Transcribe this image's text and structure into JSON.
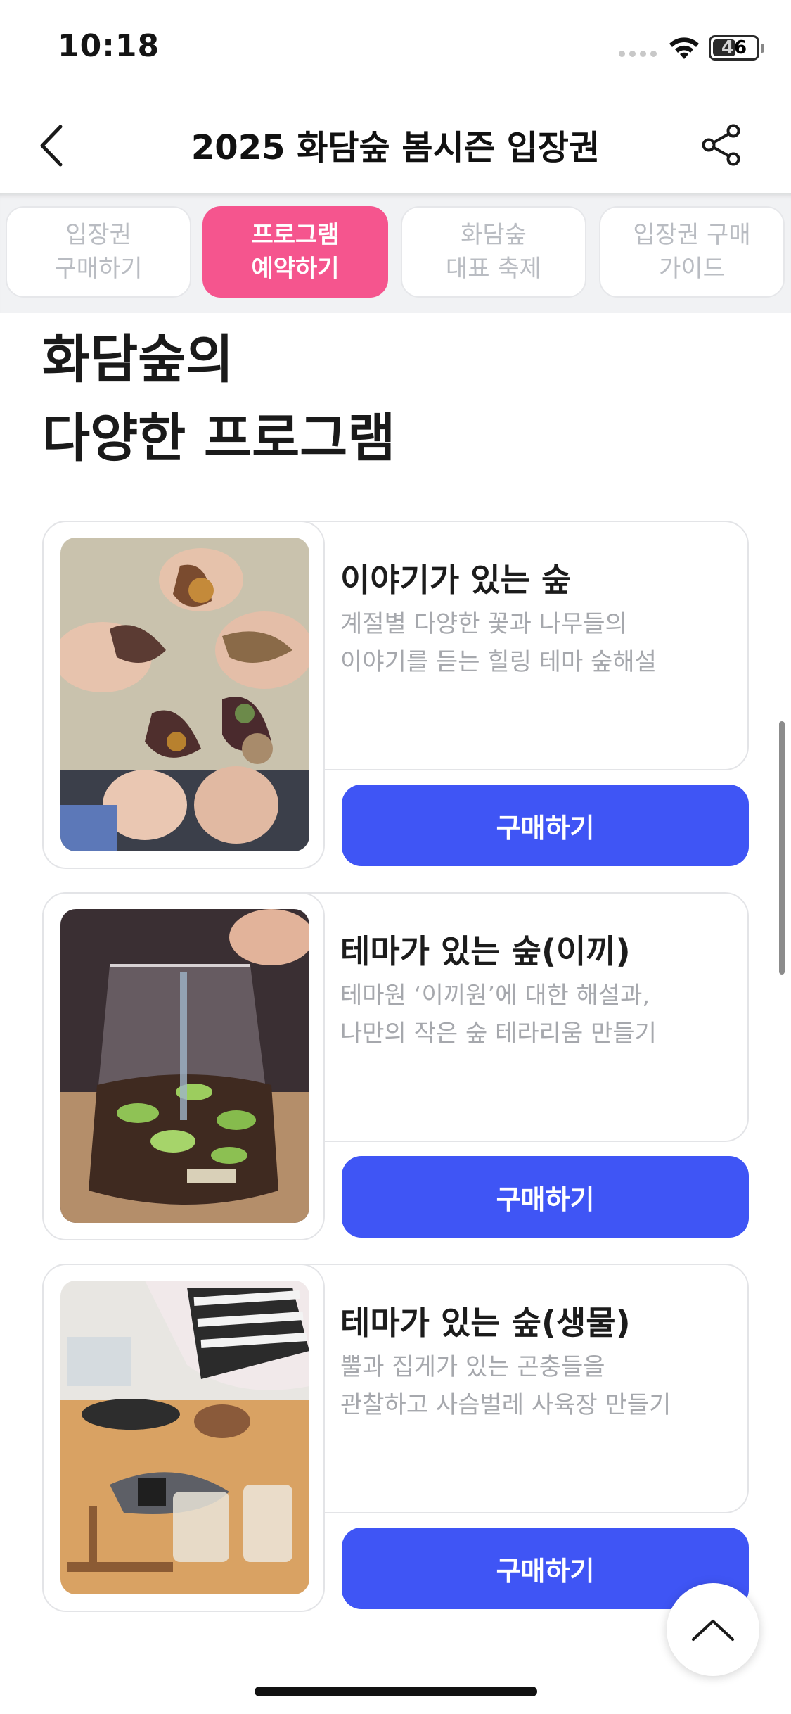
{
  "status_bar": {
    "time": "10:18",
    "battery": "46",
    "icons": [
      "signal-dots-icon",
      "wifi-icon",
      "battery-icon"
    ]
  },
  "header": {
    "title": "2025 화담숲 봄시즌 입장권",
    "back_icon": "chevron-left-icon",
    "share_icon": "share-icon"
  },
  "tabs": [
    {
      "label": "입장권\n구매하기",
      "active": false
    },
    {
      "label": "프로그램\n예약하기",
      "active": true
    },
    {
      "label": "화담숲\n대표 축제",
      "active": false
    },
    {
      "label": "입장권 구매\n가이드",
      "active": false
    }
  ],
  "section": {
    "heading": "화담숲의\n다양한 프로그램"
  },
  "programs": [
    {
      "title": "이야기가 있는 숲",
      "description": "계절별 다양한 꽃과 나무들의\n이야기를 듣는 힐링 테마 숲해설",
      "button": "구매하기",
      "photo": "hands-holding-leaves-photo"
    },
    {
      "title": "테마가 있는 숲(이끼)",
      "description": "테마원 ‘이끼원’에 대한 해설과,\n나만의 작은 숲 테라리움 만들기",
      "button": "구매하기",
      "photo": "moss-terrarium-photo"
    },
    {
      "title": "테마가 있는 숲(생물)",
      "description": "뿔과 집게가 있는 곤충들을\n관찰하고 사슴벌레 사육장 만들기",
      "button": "구매하기",
      "photo": "insect-habitat-workshop-photo"
    }
  ],
  "floating": {
    "to_top_icon": "chevron-up-icon"
  },
  "colors": {
    "accent_pink": "#f5558e",
    "button_blue": "#3f55f5",
    "muted_text": "#a6a8ad"
  }
}
